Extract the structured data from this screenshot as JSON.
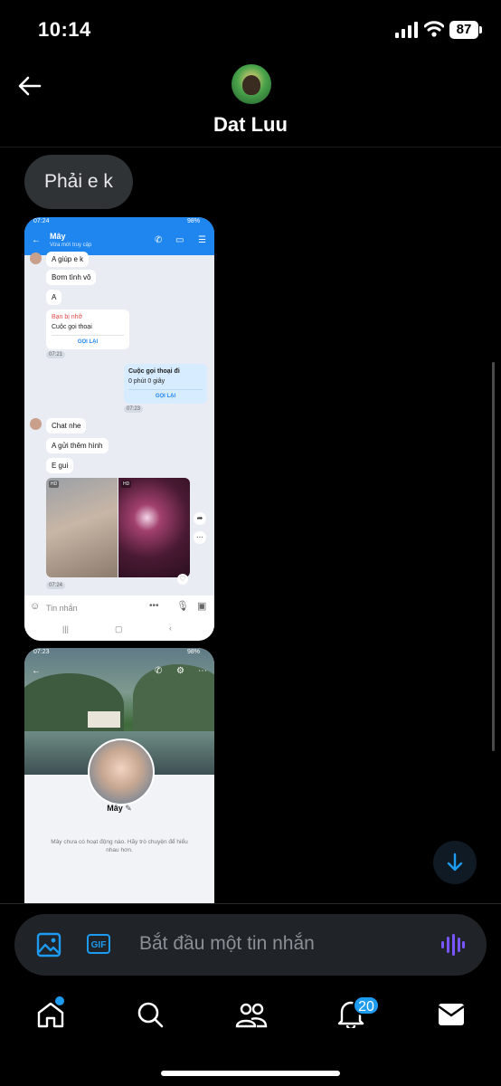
{
  "status_bar": {
    "time": "10:14",
    "battery": "87"
  },
  "header": {
    "contact_name": "Dat Luu"
  },
  "messages": [
    {
      "text": "Phải e k"
    }
  ],
  "attachment_1": {
    "status_time": "07:24",
    "status_right": "98%",
    "chat_title": "Mây",
    "chat_subtitle": "Vừa mới truy cập",
    "bubbles": [
      "A giúp e k",
      "Bơm tình vô",
      "A"
    ],
    "missed_label": "Bạn bị nhỡ",
    "missed_call": "Cuộc gọi thoại",
    "call_back": "GỌI LẠI",
    "ts1": "07:21",
    "outgoing_title": "Cuộc gọi thoại đi",
    "outgoing_duration": "0 phút 0 giây",
    "ts2": "07:23",
    "bubbles2": [
      "Chat nhe",
      "A gửi thêm hình",
      "E gui"
    ],
    "hd": "HD",
    "ts3": "07:24",
    "input_placeholder": "Tin nhắn"
  },
  "attachment_2": {
    "status_time": "07:23",
    "status_right": "98%",
    "profile_name": "Mây",
    "profile_desc": "Mây chưa có hoạt động nào. Hãy trò chuyện để hiểu nhau hơn."
  },
  "composer": {
    "placeholder": "Bắt đầu một tin nhắn",
    "gif_label": "GIF"
  },
  "bottom_nav": {
    "notification_count": "20"
  },
  "colors": {
    "accent": "#1d9bf0",
    "voice": "#7856ff",
    "bubble": "#2f3336"
  }
}
